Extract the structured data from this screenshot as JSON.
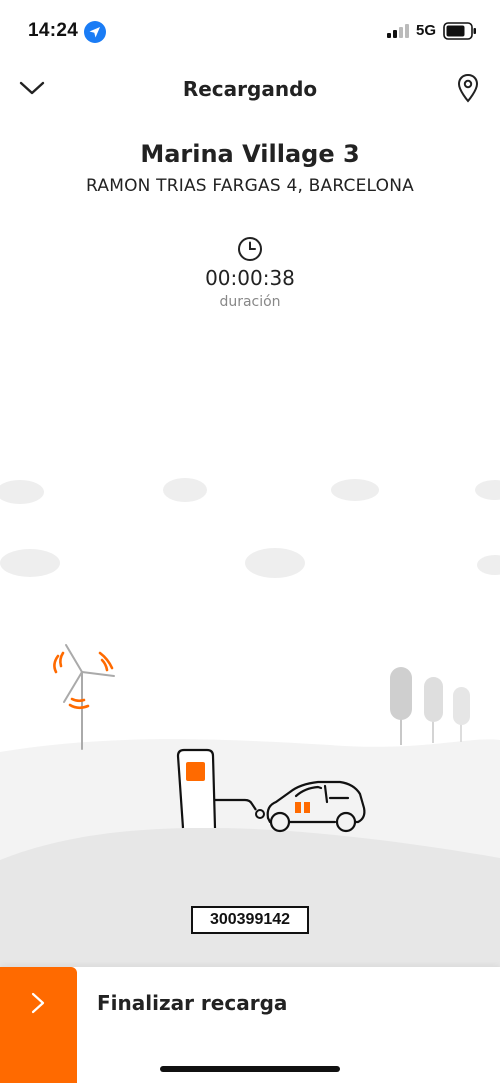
{
  "status_bar": {
    "time": "14:24",
    "network": "5G",
    "icons": [
      "location-arrow-icon",
      "signal-icon",
      "battery-icon"
    ]
  },
  "header": {
    "title": "Recargando",
    "back_icon": "chevron-down-icon",
    "map_icon": "map-pin-icon"
  },
  "station": {
    "name": "Marina Village 3",
    "address": "RAMON TRIAS FARGAS 4, BARCELONA"
  },
  "session": {
    "duration": "00:00:38",
    "duration_label": "duración",
    "clock_icon": "clock-icon"
  },
  "charger": {
    "id": "300399142"
  },
  "actions": {
    "finish_label": "Finalizar recarga",
    "finish_icon": "chevron-right-icon"
  },
  "colors": {
    "accent": "#ff6a00",
    "text": "#222222",
    "muted": "#888888"
  }
}
